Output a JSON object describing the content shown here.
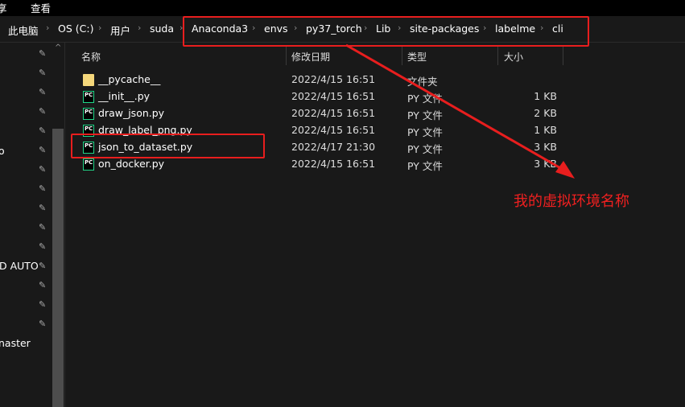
{
  "ribbon": {
    "tabs": [
      "享",
      "查看"
    ]
  },
  "breadcrumb": [
    "此电脑",
    "OS (C:)",
    "用户",
    "suda",
    "Anaconda3",
    "envs",
    "py37_torch",
    "Lib",
    "site-packages",
    "labelme",
    "cli"
  ],
  "sidebar": {
    "items": [
      "o",
      "D AUTO",
      "naster"
    ]
  },
  "columns": {
    "name": "名称",
    "date": "修改日期",
    "type": "类型",
    "size": "大小"
  },
  "files": [
    {
      "name": "__pycache__",
      "date": "2022/4/15 16:51",
      "type": "文件夹",
      "size": "",
      "icon": "folder-icon"
    },
    {
      "name": "__init__.py",
      "date": "2022/4/15 16:51",
      "type": "PY 文件",
      "size": "1 KB",
      "icon": "pycharm-file-icon"
    },
    {
      "name": "draw_json.py",
      "date": "2022/4/15 16:51",
      "type": "PY 文件",
      "size": "2 KB",
      "icon": "pycharm-file-icon"
    },
    {
      "name": "draw_label_png.py",
      "date": "2022/4/15 16:51",
      "type": "PY 文件",
      "size": "1 KB",
      "icon": "pycharm-file-icon"
    },
    {
      "name": "json_to_dataset.py",
      "date": "2022/4/17 21:30",
      "type": "PY 文件",
      "size": "3 KB",
      "icon": "pycharm-file-icon"
    },
    {
      "name": "on_docker.py",
      "date": "2022/4/15 16:51",
      "type": "PY 文件",
      "size": "3 KB",
      "icon": "pycharm-file-icon"
    }
  ],
  "annotation": {
    "text": "我的虚拟环境名称",
    "color": "#e81e1e"
  },
  "icon_label": "PC"
}
